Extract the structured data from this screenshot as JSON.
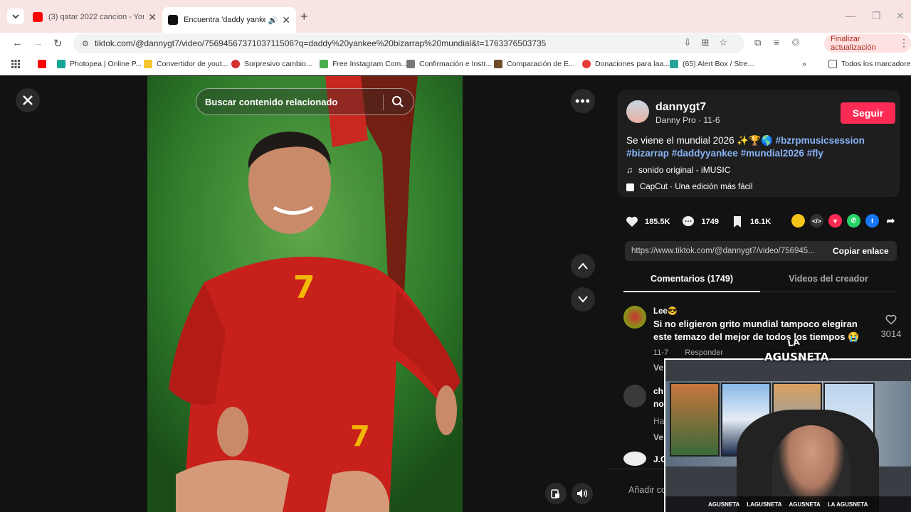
{
  "browser": {
    "tabs": [
      {
        "title": "(3) qatar 2022 cancion - YouTube",
        "active": false
      },
      {
        "title": "Encuentra 'daddy yankee b",
        "active": true
      }
    ],
    "url": "tiktok.com/@dannygt7/video/7569456737103711506?q=daddy%20yankee%20bizarrap%20mundial&t=1763376503735",
    "update_button": "Finalizar actualización",
    "bookmarks": [
      "Photopea | Online P...",
      "Convertidor de yout...",
      "Sorpresivo cambio...",
      "Free Instagram Com...",
      "Confirmación e Instr...",
      "Comparación de E...",
      "Donaciones para laa...",
      "(65) Alert Box / Stre..."
    ],
    "all_bookmarks": "Todos los marcadores"
  },
  "video": {
    "search_placeholder": "Buscar contenido relacionado"
  },
  "post": {
    "username": "dannygt7",
    "subtitle": "Danny Pro · 11-6",
    "follow_label": "Seguir",
    "caption_text": "Se viene el mundial 2026 ✨🏆🌎",
    "tags_line1": "#bzrpmusicsession",
    "tags_line2": "#bizarrap #daddyyankee #mundial2026 #fly",
    "sound": "sonido original - iMUSIC",
    "capcut": "CapCut · Una edición más fácil",
    "likes": "185.5K",
    "comments": "1749",
    "saves": "16.1K",
    "link": "https://www.tiktok.com/@dannygt7/video/756945...",
    "copy_label": "Copiar enlace"
  },
  "tabs": {
    "comments_label": "Comentarios (1749)",
    "creator_label": "Videos del creador"
  },
  "comments": [
    {
      "user": "Lee😎",
      "text": "Si no eligieron grito mundial tampoco elegiran este temazo del mejor de todos los tiempos 😭",
      "date": "11-7",
      "reply": "Responder",
      "likes": "3014",
      "more": "Ve"
    },
    {
      "user": "ch",
      "text": "no",
      "date": "Ha",
      "more": "Ve"
    },
    {
      "user": "J.C"
    }
  ],
  "add_comment_placeholder": "Añadir co",
  "overlay": {
    "logo_line1": "LA",
    "logo_line2": "AGUSNETA",
    "socials": [
      "AGUSNETA",
      "LAGUSNETA",
      "AGUSNETA",
      "LA AGUSNETA"
    ]
  }
}
